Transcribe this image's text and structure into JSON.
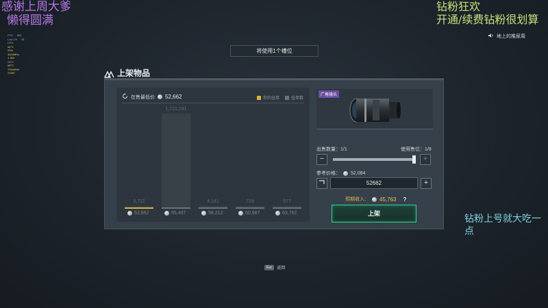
{
  "overlays": {
    "thanks": "感谢上周大爹",
    "lazy": "懒得圆满",
    "promo1": "钻粉狂欢",
    "promo2": "开通/续费钻粉很划算",
    "side": "钻粉上号就大吃一点"
  },
  "perf": {
    "fps_label": "FPS",
    "fps": "204",
    "low_label": "Low 1%",
    "low": "91",
    "cpu_label": "CPU",
    "cpu": [
      "84°C",
      "29%",
      "3404MHz",
      "1.35V"
    ],
    "gpu_label": "GPU",
    "gpu": [
      "68°C",
      "79%/85%",
      "215W"
    ]
  },
  "sound": {
    "label": "地上的推尿周"
  },
  "banner": {
    "text": "将使用1个槽位"
  },
  "panel": {
    "title": "上架物品"
  },
  "chart_header": {
    "label": "在售最低价",
    "price": "52,662",
    "legend_mine": "你的挂单",
    "legend_other": "挂单数"
  },
  "chart_data": {
    "type": "bar",
    "categories": [
      "52,662",
      "55,437",
      "58,212",
      "60,987",
      "63,762"
    ],
    "values": [
      3722,
      1721241,
      4141,
      728,
      577
    ],
    "labels": [
      "3,722",
      "1,721,241",
      "4,141",
      "728",
      "577"
    ],
    "highlight_index": 0,
    "colors": {
      "bar": "#384048",
      "highlight": "#d8b23a",
      "line": "#6b747c"
    }
  },
  "item": {
    "tag": "广角镜头"
  },
  "sell": {
    "qty_label": "出售数量：",
    "qty_value": "1/1",
    "slots_label": "使用售位：",
    "slots_value": "1/8",
    "minus": "−",
    "plus": "+",
    "ref_label": "参考价格：",
    "ref_price": "52,084",
    "price_value": "52662",
    "income_label": "预期收入：",
    "income_value": "45,763",
    "help": "?",
    "list_button": "上架"
  },
  "footer": {
    "esc_key": "Esc",
    "esc_label": "返回"
  },
  "colors": {
    "accent": "#2fd398",
    "gold": "#d8b23a",
    "panel": "#36404a"
  }
}
